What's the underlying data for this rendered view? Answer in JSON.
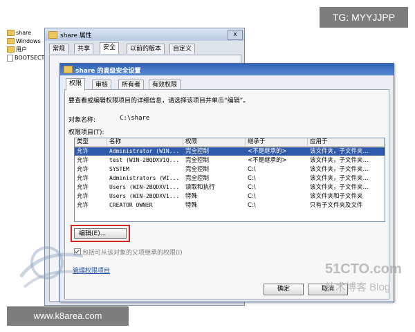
{
  "watermarks": {
    "tg": "TG: MYYJJPP",
    "site": "www.k8area.com",
    "cto": "51CTO.com",
    "blog": "技术博客 Blog"
  },
  "explorer": {
    "items": [
      {
        "label": "share",
        "icon": "folder-icon"
      },
      {
        "label": "Windows",
        "icon": "folder-icon"
      },
      {
        "label": "用户",
        "icon": "folder-icon"
      },
      {
        "label": "BOOTSECT.",
        "icon": "file-icon"
      }
    ]
  },
  "properties_window": {
    "title": "share 属性",
    "close": "x",
    "tabs": [
      "常规",
      "共享",
      "安全",
      "以前的版本",
      "自定义"
    ]
  },
  "advanced_window": {
    "title": "share 的高级安全设置",
    "tabs": [
      "权限",
      "审核",
      "所有者",
      "有效权限"
    ],
    "instruction": "要查看或编辑权限项目的详细信息，请选择该项目并单击“编辑”。",
    "object_label": "对象名称:",
    "object_value": "C:\\share",
    "perm_list_label": "权限项目(T):",
    "columns": [
      "类型",
      "名称",
      "权限",
      "继承于",
      "应用于"
    ],
    "rows": [
      {
        "type": "允许",
        "name": "Administrator (WIN...",
        "perm": "完全控制",
        "inherit": "<不是继承的>",
        "apply": "该文件夹，子文件夹..."
      },
      {
        "type": "允许",
        "name": "test (WIN-2BQDXV1Q...",
        "perm": "完全控制",
        "inherit": "<不是继承的>",
        "apply": "该文件夹，子文件夹..."
      },
      {
        "type": "允许",
        "name": "SYSTEM",
        "perm": "完全控制",
        "inherit": "C:\\",
        "apply": "该文件夹，子文件夹..."
      },
      {
        "type": "允许",
        "name": "Administrators (WI...",
        "perm": "完全控制",
        "inherit": "C:\\",
        "apply": "该文件夹，子文件夹..."
      },
      {
        "type": "允许",
        "name": "Users (WIN-2BQDXV1...",
        "perm": "读取和执行",
        "inherit": "C:\\",
        "apply": "该文件夹，子文件夹..."
      },
      {
        "type": "允许",
        "name": "Users (WIN-2BQDXV1...",
        "perm": "特殊",
        "inherit": "C:\\",
        "apply": "该文件夹和子文件夹"
      },
      {
        "type": "允许",
        "name": "CREATOR OWNER",
        "perm": "特殊",
        "inherit": "C:\\",
        "apply": "只有子文件夹及文件"
      }
    ],
    "edit_button": "编辑(E)...",
    "inherit_checkbox": "包括可从该对象的父项继承的权限(I)",
    "manage_link": "管理权限项目",
    "ok_button": "确定",
    "cancel_button": "取消"
  },
  "colors": {
    "title_bar": "#2f63b8",
    "selection": "#2f5aaa",
    "highlight_box": "#d42424"
  }
}
